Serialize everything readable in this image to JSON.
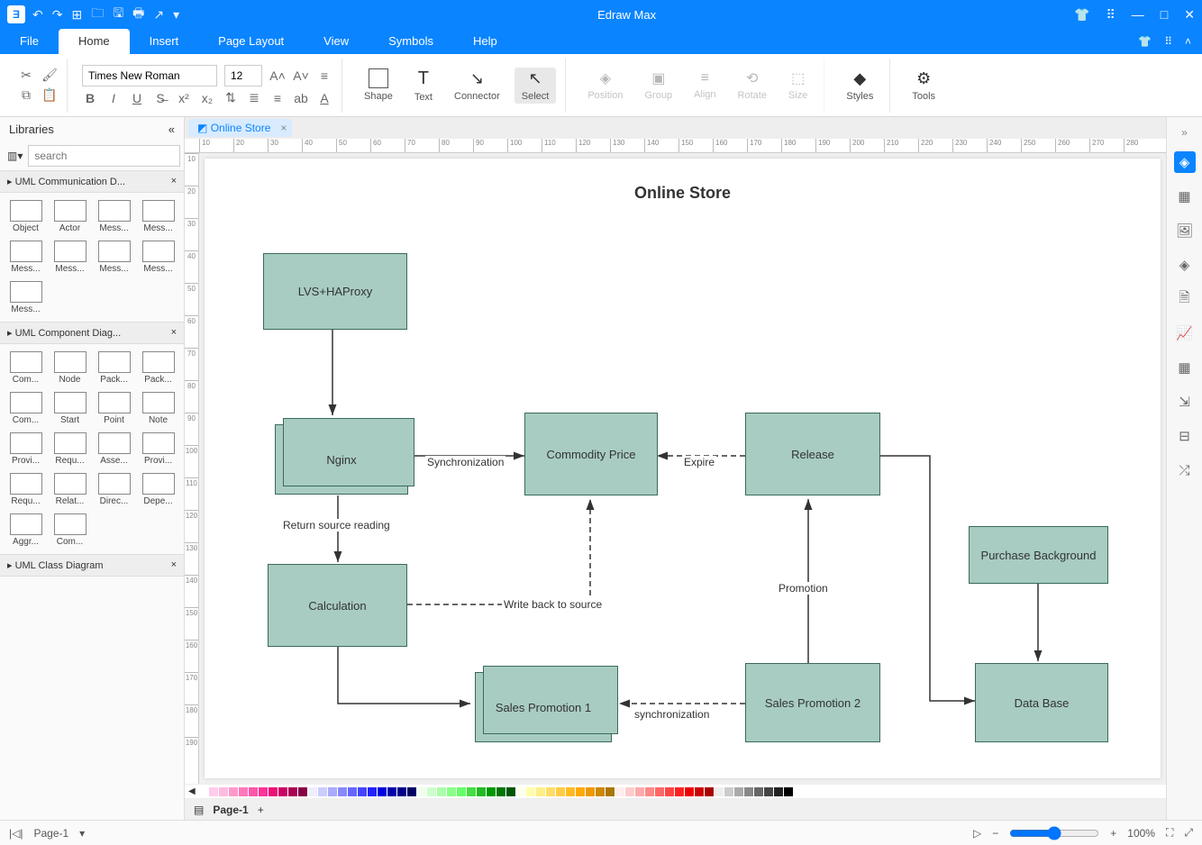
{
  "app": {
    "title": "Edraw Max"
  },
  "menus": [
    "File",
    "Home",
    "Insert",
    "Page Layout",
    "View",
    "Symbols",
    "Help"
  ],
  "active_menu": "Home",
  "ribbon": {
    "font_name": "Times New Roman",
    "font_size": "12",
    "shape": "Shape",
    "text": "Text",
    "connector": "Connector",
    "select": "Select",
    "position": "Position",
    "group": "Group",
    "align": "Align",
    "rotate": "Rotate",
    "size": "Size",
    "styles": "Styles",
    "tools": "Tools"
  },
  "sidebar": {
    "title": "Libraries",
    "search_placeholder": "search",
    "sections": [
      {
        "name": "UML Communication D...",
        "items": [
          "Object",
          "Actor",
          "Mess...",
          "Mess...",
          "Mess...",
          "Mess...",
          "Mess...",
          "Mess...",
          "Mess..."
        ]
      },
      {
        "name": "UML Component Diag...",
        "items": [
          "Com...",
          "Node",
          "Pack...",
          "Pack...",
          "Com...",
          "Start",
          "Point",
          "Note",
          "Provi...",
          "Requ...",
          "Asse...",
          "Provi...",
          "Requ...",
          "Relat...",
          "Direc...",
          "Depe...",
          "Aggr...",
          "Com..."
        ]
      },
      {
        "name": "UML Class Diagram",
        "items": []
      }
    ]
  },
  "doc_tab": "Online Store",
  "diagram": {
    "title": "Online Store",
    "nodes": {
      "lvs": "LVS+HAProxy",
      "nginx": "Nginx",
      "price": "Commodity Price",
      "release": "Release",
      "calc": "Calculation",
      "promo1": "Sales Promotion 1",
      "promo2": "Sales Promotion 2",
      "purchase": "Purchase Background",
      "db": "Data Base"
    },
    "labels": {
      "sync": "Synchronization",
      "expire": "Expire",
      "return": "Return source reading",
      "write": "Write back to source",
      "promotion": "Promotion",
      "sync2": "synchronization"
    }
  },
  "ruler_h": [
    "10",
    "20",
    "30",
    "40",
    "50",
    "60",
    "70",
    "80",
    "90",
    "100",
    "110",
    "120",
    "130",
    "140",
    "150",
    "160",
    "170",
    "180",
    "190",
    "200",
    "210",
    "220",
    "230",
    "240",
    "250",
    "260",
    "270",
    "280"
  ],
  "ruler_v": [
    "10",
    "20",
    "30",
    "40",
    "50",
    "60",
    "70",
    "80",
    "90",
    "100",
    "110",
    "120",
    "130",
    "140",
    "150",
    "160",
    "170",
    "180",
    "190"
  ],
  "status": {
    "page_select": "Page-1",
    "page_tab": "Page-1",
    "zoom": "100%"
  }
}
